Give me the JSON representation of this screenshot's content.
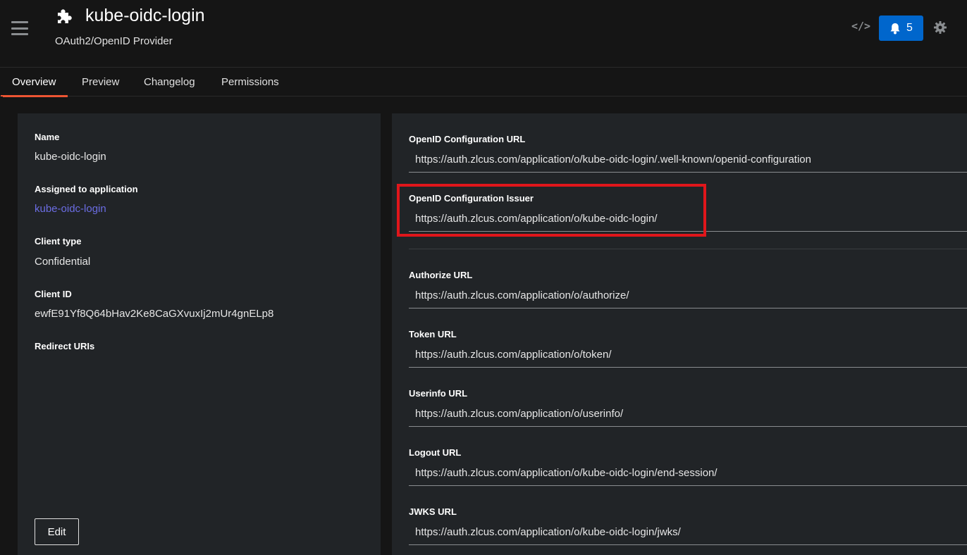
{
  "header": {
    "title": "kube-oidc-login",
    "subtitle": "OAuth2/OpenID Provider",
    "title_icon": "puzzle-icon",
    "notification_count": "5",
    "api_icon": "</>"
  },
  "tabs": [
    {
      "label": "Overview"
    },
    {
      "label": "Preview"
    },
    {
      "label": "Changelog"
    },
    {
      "label": "Permissions"
    }
  ],
  "details": {
    "name_label": "Name",
    "name_value": "kube-oidc-login",
    "app_label": "Assigned to application",
    "app_value": "kube-oidc-login",
    "client_type_label": "Client type",
    "client_type_value": "Confidential",
    "client_id_label": "Client ID",
    "client_id_value": "ewfE91Yf8Q64bHav2Ke8CaGXvuxIj2mUr4gnELp8",
    "redirect_label": "Redirect URIs",
    "edit_label": "Edit"
  },
  "urls": {
    "openid_config_label": "OpenID Configuration URL",
    "openid_config_value": "https://auth.zlcus.com/application/o/kube-oidc-login/.well-known/openid-configuration",
    "issuer_label": "OpenID Configuration Issuer",
    "issuer_value": "https://auth.zlcus.com/application/o/kube-oidc-login/",
    "authorize_label": "Authorize URL",
    "authorize_value": "https://auth.zlcus.com/application/o/authorize/",
    "token_label": "Token URL",
    "token_value": "https://auth.zlcus.com/application/o/token/",
    "userinfo_label": "Userinfo URL",
    "userinfo_value": "https://auth.zlcus.com/application/o/userinfo/",
    "logout_label": "Logout URL",
    "logout_value": "https://auth.zlcus.com/application/o/kube-oidc-login/end-session/",
    "jwks_label": "JWKS URL",
    "jwks_value": "https://auth.zlcus.com/application/o/kube-oidc-login/jwks/"
  },
  "colors": {
    "accent": "#0066cc",
    "tab_underline": "#ee5533",
    "highlight": "#e0161b",
    "link": "#6b6de3"
  }
}
